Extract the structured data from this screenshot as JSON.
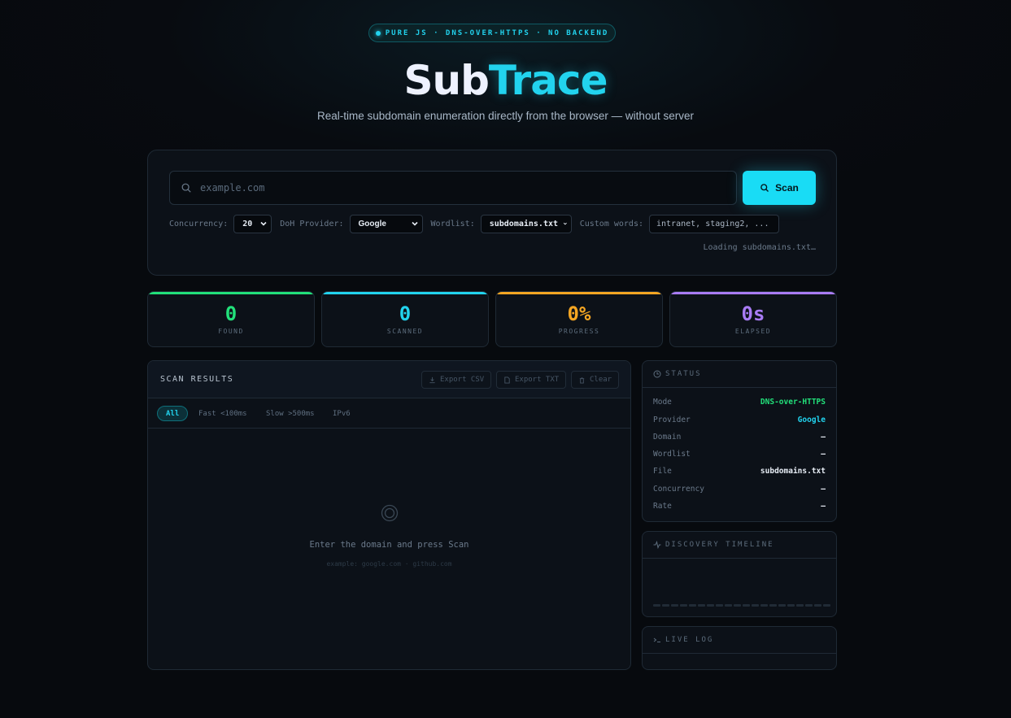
{
  "header": {
    "badge": "PURE JS · DNS-OVER-HTTPS · NO BACKEND",
    "title_part1": "Sub",
    "title_part2": "Trace",
    "subtitle": "Real-time subdomain enumeration directly from the browser — without server"
  },
  "search": {
    "placeholder": "example.com",
    "value": "",
    "scan_label": "Scan",
    "concurrency_label": "Concurrency:",
    "concurrency_value": "20",
    "doh_label": "DoH Provider:",
    "doh_value": "Google",
    "wordlist_label": "Wordlist:",
    "wordlist_value": "subdomains.txt",
    "custom_label": "Custom words:",
    "custom_placeholder": "intranet, staging2, ...",
    "loading_text": "Loading subdomains.txt…"
  },
  "stats": [
    {
      "value": "0",
      "label": "FOUND",
      "color": "#22e07a"
    },
    {
      "value": "0",
      "label": "SCANNED",
      "color": "#22d3ee"
    },
    {
      "value": "0%",
      "label": "PROGRESS",
      "color": "#f5a623"
    },
    {
      "value": "0s",
      "label": "ELAPSED",
      "color": "#a97cf5"
    }
  ],
  "results": {
    "title": "SCAN RESULTS",
    "export_csv": "Export CSV",
    "export_txt": "Export TXT",
    "clear": "Clear",
    "filters": [
      "All",
      "Fast <100ms",
      "Slow >500ms",
      "IPv6"
    ],
    "empty_main": "Enter the domain and press Scan",
    "empty_sub": "example: google.com · github.com"
  },
  "status": {
    "title": "STATUS",
    "rows": [
      {
        "key": "Mode",
        "value": "DNS-over-HTTPS",
        "color": "#22e07a"
      },
      {
        "key": "Provider",
        "value": "Google",
        "color": "#22d3ee"
      },
      {
        "key": "Domain",
        "value": "—",
        "color": "#e7edf5"
      },
      {
        "key": "Wordlist",
        "value": "—",
        "color": "#e7edf5"
      },
      {
        "key": "File",
        "value": "subdomains.txt",
        "color": "#e7edf5"
      },
      {
        "key": "Concurrency",
        "value": "—",
        "color": "#e7edf5"
      },
      {
        "key": "Rate",
        "value": "—",
        "color": "#e7edf5"
      }
    ]
  },
  "timeline": {
    "title": "DISCOVERY TIMELINE"
  },
  "livelog": {
    "title": "LIVE LOG"
  }
}
